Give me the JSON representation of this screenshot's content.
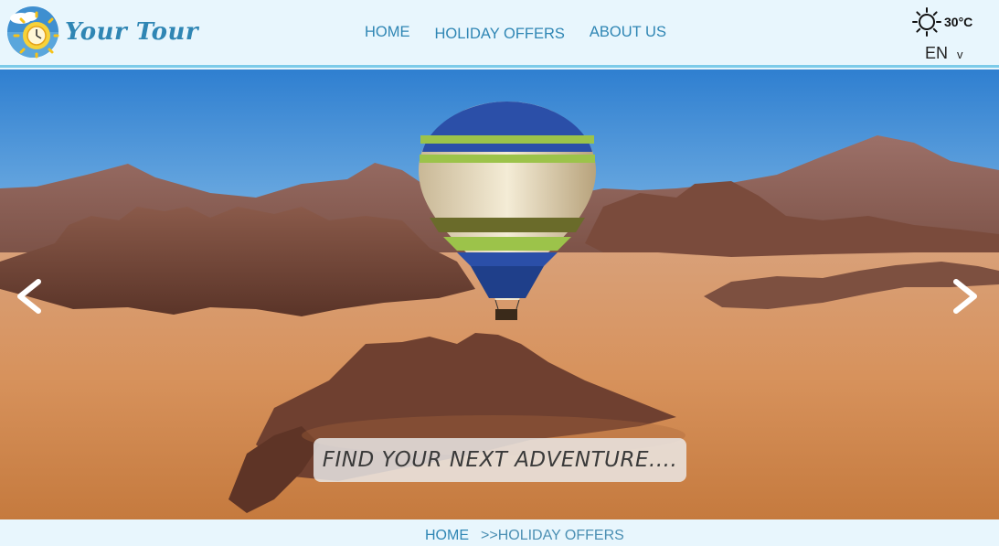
{
  "brand": {
    "name": "Your Tour"
  },
  "nav": {
    "items": [
      {
        "label": "HOME"
      },
      {
        "label": "HOLIDAY OFFERS"
      },
      {
        "label": "ABOUT US"
      }
    ]
  },
  "weather": {
    "icon": "sun-icon",
    "temperature": "30°C"
  },
  "language": {
    "selected": "EN",
    "caret": "v"
  },
  "hero": {
    "tagline": "FIND YOUR NEXT ADVENTURE....",
    "prev_arrow": "<",
    "next_arrow": ">"
  },
  "breadcrumb": {
    "home": "HOME",
    "current": ">>HOLIDAY OFFERS"
  },
  "colors": {
    "header_bg": "#e8f6fd",
    "header_border": "#7ccbe9",
    "nav_text": "#2f86b4",
    "sky": "#3d8fd6",
    "sand": "#d99a66"
  }
}
